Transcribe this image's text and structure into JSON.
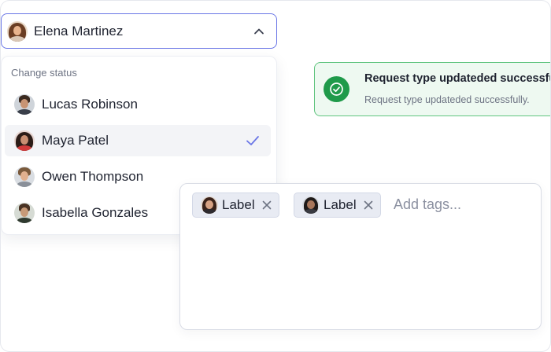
{
  "select": {
    "current_name": "Elena Martinez",
    "accent": "#6a76e6"
  },
  "dropdown": {
    "heading": "Change status",
    "options": [
      {
        "label": "Lucas Robinson",
        "selected": false
      },
      {
        "label": "Maya Patel",
        "selected": true
      },
      {
        "label": "Owen Thompson",
        "selected": false
      },
      {
        "label": "Isabella Gonzales",
        "selected": false
      }
    ]
  },
  "toast": {
    "title": "Request type updateded successfully",
    "message": "Request type updateded successfully.",
    "color": "#1f9a4a"
  },
  "tag_input": {
    "tags": [
      {
        "label": "Label"
      },
      {
        "label": "Label"
      }
    ],
    "placeholder": "Add tags..."
  },
  "icons": {
    "chevron": "chevron-up-icon",
    "check": "check-icon",
    "success": "check-circle-icon",
    "remove": "close-icon"
  }
}
